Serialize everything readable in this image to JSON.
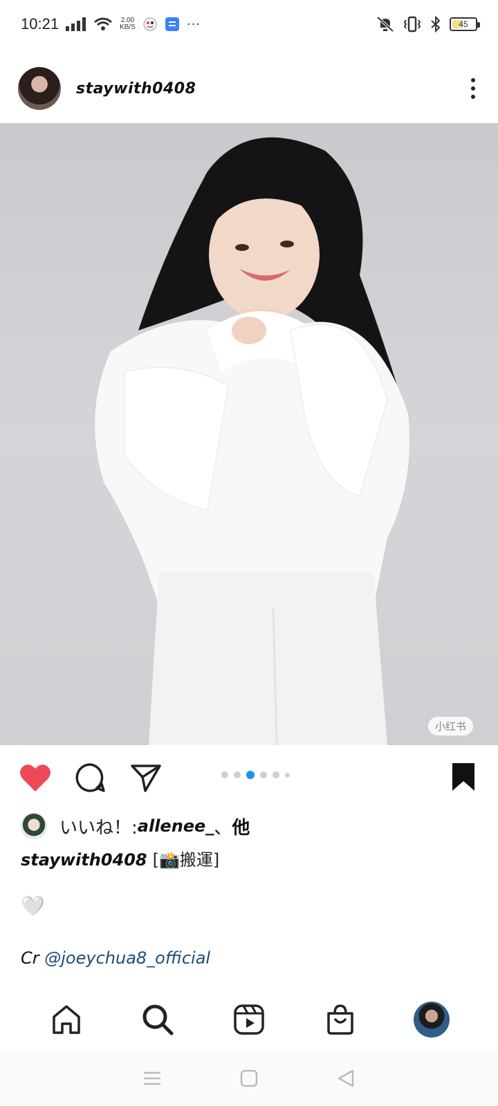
{
  "status_bar": {
    "time": "10:21",
    "net_speed_value": "2.00",
    "net_speed_unit": "KB/S",
    "overflow": "···",
    "battery_level": "45",
    "battery_fraction": 0.45
  },
  "post": {
    "username": "staywith0408",
    "watermark": "小红书",
    "carousel": {
      "count": 6,
      "active_index": 2
    }
  },
  "likes": {
    "label": "いいね！: ",
    "first_liker": "allenee_",
    "separator": "、",
    "others": "他"
  },
  "caption": {
    "username": "staywith0408",
    "text": "[📸搬運]",
    "heart": "🤍",
    "credit_prefix": "Cr ",
    "credit_mention": "@joeychua8_official"
  },
  "colors": {
    "like_red": "#ed4956",
    "active_dot": "#1b95e0",
    "mention": "#1a4d7a"
  },
  "tabs": [
    "home-icon",
    "search-icon",
    "reels-icon",
    "shop-icon",
    "profile-avatar"
  ]
}
